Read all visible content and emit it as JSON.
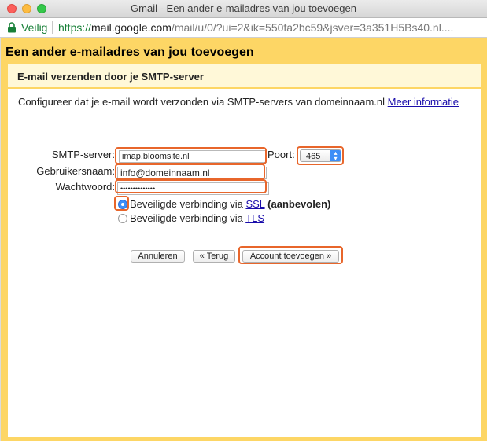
{
  "window": {
    "title": "Gmail - Een ander e-mailadres van jou toevoegen"
  },
  "address_bar": {
    "security_label": "Veilig",
    "url_scheme": "https://",
    "url_host": "mail.google.com",
    "url_rest": "/mail/u/0/?ui=2&ik=550fa2bc59&jsver=3a351H5Bs40.nl...."
  },
  "page": {
    "title": "Een ander e-mailadres van jou toevoegen",
    "section_title": "E-mail verzenden door je SMTP-server",
    "description": "Configureer dat je e-mail wordt verzonden via SMTP-servers van domeinnaam.nl",
    "more_info_link": "Meer informatie"
  },
  "form": {
    "smtp_label": "SMTP-server:",
    "smtp_value": "imap.bloomsite.nl",
    "port_label": "Poort:",
    "port_value": "465",
    "username_label": "Gebruikersnaam:",
    "username_value": "info@domeinnaam.nl",
    "password_label": "Wachtwoord:",
    "password_value": "••••••••••••••",
    "ssl_label_prefix": "Beveiligde verbinding via",
    "ssl_link": "SSL",
    "ssl_suffix": "(aanbevolen)",
    "tls_label_prefix": "Beveiligde verbinding via",
    "tls_link": "TLS",
    "selected_security": "SSL"
  },
  "buttons": {
    "cancel": "Annuleren",
    "back": "« Terug",
    "add": "Account toevoegen »"
  },
  "colors": {
    "header_bg": "#fdd665",
    "highlight": "#e8662b",
    "link": "#1a0dab",
    "secure": "#188038",
    "select_accent": "#3d8ef7"
  }
}
